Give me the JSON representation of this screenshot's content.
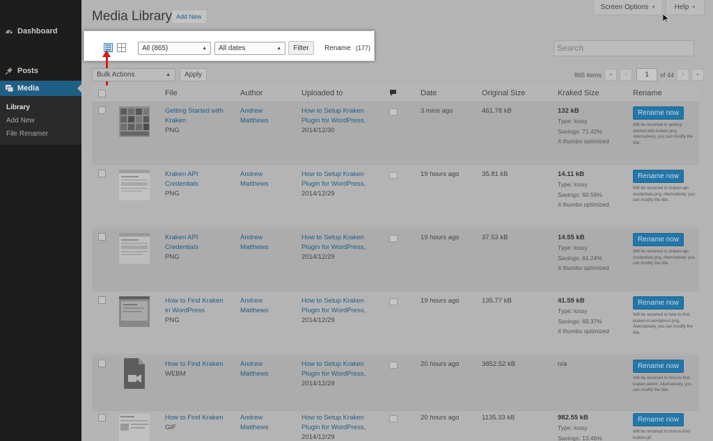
{
  "sidebar": {
    "items": [
      {
        "label": "Dashboard"
      },
      {
        "label": "Posts"
      },
      {
        "label": "Media"
      }
    ],
    "submenu": [
      "Library",
      "Add New",
      "File Renamer"
    ]
  },
  "header": {
    "title": "Media Library",
    "add_new": "Add New",
    "screen_options": "Screen Options",
    "help": "Help"
  },
  "filters": {
    "type_select": "All (865)",
    "date_select": "All dates",
    "filter_btn": "Filter",
    "rename_label": "Rename",
    "rename_count": "(177)"
  },
  "search": {
    "placeholder": "Search"
  },
  "bulk": {
    "label": "Bulk Actions",
    "apply": "Apply"
  },
  "pagination": {
    "items": "865 items",
    "current": "1",
    "of": "of 44",
    "first": "«",
    "prev": "‹",
    "next": "›",
    "last": "»"
  },
  "columns": {
    "file": "File",
    "author": "Author",
    "uploaded": "Uploaded to",
    "date": "Date",
    "original": "Original Size",
    "kraked": "Kraked Size",
    "rename": "Rename"
  },
  "rows": [
    {
      "title": [
        "Getting Started with",
        "Kraken"
      ],
      "type": "PNG",
      "author": [
        "Andrew",
        "Matthews"
      ],
      "uploaded_link": [
        "How to Setup Kraken",
        "Plugin for WordPress,"
      ],
      "uploaded_date": "2014/12/30",
      "date": "3 mins ago",
      "original": "461.78 kB",
      "kraked": "132 kB",
      "kraked_lines": [
        "Type: lossy",
        "Savings: 71.42%",
        "4 thumbs optimized"
      ],
      "rename_btn": "Rename now",
      "rename_note": "Will be renamed to getting-started-with-kraken.png. Alternatively, you can modify the title."
    },
    {
      "title": [
        "Kraken API",
        "Credentials"
      ],
      "type": "PNG",
      "author": [
        "Andrew",
        "Matthews"
      ],
      "uploaded_link": [
        "How to Setup Kraken",
        "Plugin for WordPress,"
      ],
      "uploaded_date": "2014/12/29",
      "date": "19 hours ago",
      "original": "35.81 kB",
      "kraked": "14.11 kB",
      "kraked_lines": [
        "Type: lossy",
        "Savings: 60.59%",
        "4 thumbs optimized"
      ],
      "rename_btn": "Rename now",
      "rename_note": "Will be renamed to kraken-api-credentials.png. Alternatively, you can modify the title."
    },
    {
      "title": [
        "Kraken API",
        "Credentials"
      ],
      "type": "PNG",
      "author": [
        "Andrew",
        "Matthews"
      ],
      "uploaded_link": [
        "How to Setup Kraken",
        "Plugin for WordPress,"
      ],
      "uploaded_date": "2014/12/29",
      "date": "19 hours ago",
      "original": "37.53 kB",
      "kraked": "14.55 kB",
      "kraked_lines": [
        "Type: lossy",
        "Savings: 61.24%",
        "4 thumbs optimized"
      ],
      "rename_btn": "Rename now",
      "rename_note": "Will be renamed to kraken-api-credentials.png. Alternatively, you can modify the title."
    },
    {
      "title": [
        "How to Find Kraken",
        "in WordPress"
      ],
      "type": "PNG",
      "author": [
        "Andrew",
        "Matthews"
      ],
      "uploaded_link": [
        "How to Setup Kraken",
        "Plugin for WordPress,"
      ],
      "uploaded_date": "2014/12/29",
      "date": "19 hours ago",
      "original": "135.77 kB",
      "kraked": "41.59 kB",
      "kraked_lines": [
        "Type: lossy",
        "Savings: 69.37%",
        "4 thumbs optimized"
      ],
      "rename_btn": "Rename now",
      "rename_note": "Will be renamed to how-to-find-kraken-in-wordpress.png. Alternatively, you can modify the title."
    },
    {
      "title": [
        "How to Find Kraken",
        ""
      ],
      "type": "WEBM",
      "author": [
        "Andrew",
        "Matthews"
      ],
      "uploaded_link": [
        "How to Setup Kraken",
        "Plugin for WordPress,"
      ],
      "uploaded_date": "2014/12/29",
      "date": "20 hours ago",
      "original": "3852.52 kB",
      "kraked": "n/a",
      "kraked_lines": [
        "",
        "",
        ""
      ],
      "rename_btn": "Rename now",
      "rename_note": "Will be renamed to how-to-find-kraken.webm. Alternatively, you can modify the title."
    },
    {
      "title": [
        "How to Find Kraken",
        ""
      ],
      "type": "GIF",
      "author": [
        "Andrew",
        "Matthews"
      ],
      "uploaded_link": [
        "How to Setup Kraken",
        "Plugin for WordPress,"
      ],
      "uploaded_date": "2014/12/29",
      "date": "20 hours ago",
      "original": "1135.33 kB",
      "kraked": "982.55 kB",
      "kraked_lines": [
        "Type: lossy",
        "Savings: 13.46%",
        ""
      ],
      "rename_btn": "Rename now",
      "rename_note": "Will be renamed to how-to-find-kraken.gif."
    }
  ]
}
